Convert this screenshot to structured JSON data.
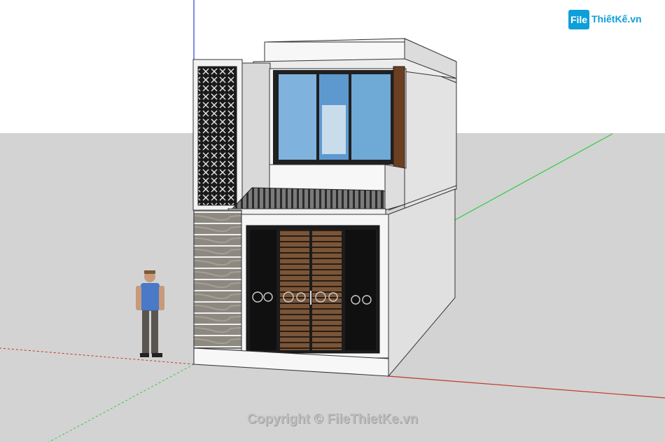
{
  "watermark": {
    "logo_badge": "File",
    "logo_text": "ThiếtKế.vn",
    "copyright": "Copyright © FileThietKe.vn"
  },
  "colors": {
    "sky": "#ffffff",
    "ground": "#d3d3d3",
    "wall_light": "#f4f4f4",
    "wall_shade": "#dcdcdc",
    "glass": "#6fa9d6",
    "wood": "#6b4a32",
    "axis_red": "#c0392b",
    "axis_green": "#2ecc40",
    "axis_blue": "#2c3ed8",
    "brand": "#0e9fd8"
  }
}
